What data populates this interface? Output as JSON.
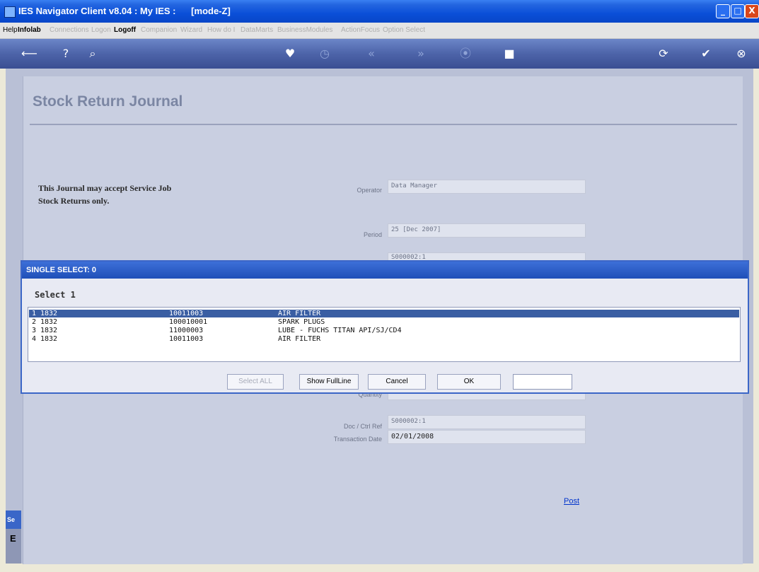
{
  "window": {
    "title": "IES Navigator Client v8.04 : My IES :      [mode-Z]",
    "minimize_label": "_",
    "maximize_label": "□",
    "close_label": "X"
  },
  "menu": [
    {
      "label": "Help",
      "state": "on"
    },
    {
      "label": "Infolab",
      "state": "bold"
    },
    {
      "label": "Connections",
      "state": "off"
    },
    {
      "label": "Logon",
      "state": "off"
    },
    {
      "label": "Logoff",
      "state": "bold"
    },
    {
      "label": "Companion",
      "state": "off"
    },
    {
      "label": "Wizard",
      "state": "off"
    },
    {
      "label": "How do I",
      "state": "off"
    },
    {
      "label": "DataMarts",
      "state": "off"
    },
    {
      "label": "BusinessModules",
      "state": "off"
    },
    {
      "label": "ActionFocus",
      "state": "off"
    },
    {
      "label": "Option Select",
      "state": "off"
    }
  ],
  "toolbar": {
    "icons": [
      "back-icon",
      "help-icon",
      "search-icon",
      "heart-icon",
      "clock-icon",
      "rewind-icon",
      "forward-icon",
      "record-icon",
      "stop-icon",
      "refresh-icon",
      "check-icon",
      "close-icon"
    ],
    "glyphs": {
      "back": "⟵",
      "help": "?",
      "search": "⌕",
      "heart": "♥",
      "clock": "◷",
      "rewind": "«",
      "forward": "»",
      "record": "⦿",
      "stop": "■",
      "refresh": "⟳",
      "check": "✔",
      "close": "⊗"
    }
  },
  "page": {
    "title": "Stock Return Journal",
    "notice_line1": "This Journal may accept Service Job",
    "notice_line2": "Stock Returns only.",
    "post_link": "Post"
  },
  "fields": {
    "operator_label": "Operator",
    "operator_value": "Data Manager",
    "period_label": "Period",
    "period_value": "25  [Dec 2007]",
    "hidden_value": "S000002:1",
    "doc_ref_label": "Doc / Ctrl Ref",
    "doc_ref_value": "S000002:1",
    "trans_date_label": "Transaction Date",
    "trans_date_value": "02/01/2008",
    "partial_label": "Quantity"
  },
  "side_tab": {
    "label": "Se",
    "letter": "E"
  },
  "dialog": {
    "title": "SINGLE SELECT: 0",
    "prompt": "Select 1",
    "rows": [
      {
        "n": "1",
        "a": "1832",
        "b": "10011003",
        "c": "AIR FILTER",
        "selected": true
      },
      {
        "n": "2",
        "a": "1832",
        "b": "100010001",
        "c": "SPARK PLUGS",
        "selected": false
      },
      {
        "n": "3",
        "a": "1832",
        "b": "11000003",
        "c": "LUBE - FUCHS TITAN API/SJ/CD4",
        "selected": false
      },
      {
        "n": "4",
        "a": "1832",
        "b": "10011003",
        "c": "AIR FILTER",
        "selected": false
      }
    ],
    "buttons": {
      "select_all": "Select ALL",
      "show_full_line": "Show FullLine",
      "cancel": "Cancel",
      "ok": "OK"
    },
    "input_value": ""
  }
}
